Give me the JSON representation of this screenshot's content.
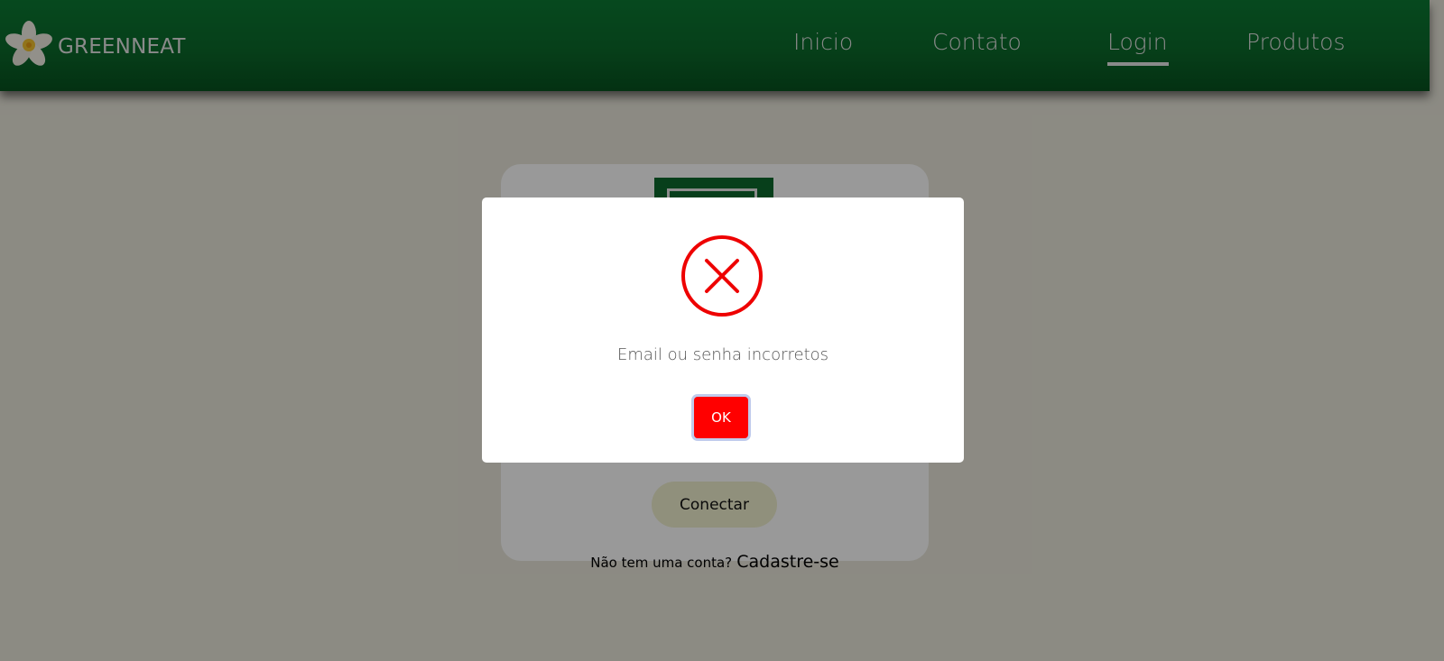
{
  "header": {
    "brand_name": "GREENNEAT",
    "logo_icon": "plumeria-flower-icon",
    "nav": [
      {
        "label": "Inicio",
        "active": false
      },
      {
        "label": "Contato",
        "active": false
      },
      {
        "label": "Login",
        "active": true
      },
      {
        "label": "Produtos",
        "active": false
      }
    ]
  },
  "login_card": {
    "connect_label": "Conectar",
    "signup_question": "Não tem uma conta?",
    "signup_link": "Cadastre-se"
  },
  "modal": {
    "icon": "error-x-icon",
    "message": "Email ou senha incorretos",
    "ok_label": "OK"
  },
  "colors": {
    "navbar": "#0a6a2b",
    "error_red": "#ff0000",
    "connect_button": "#f1f1cf",
    "overlay": "rgba(0,0,0,0.40)"
  }
}
